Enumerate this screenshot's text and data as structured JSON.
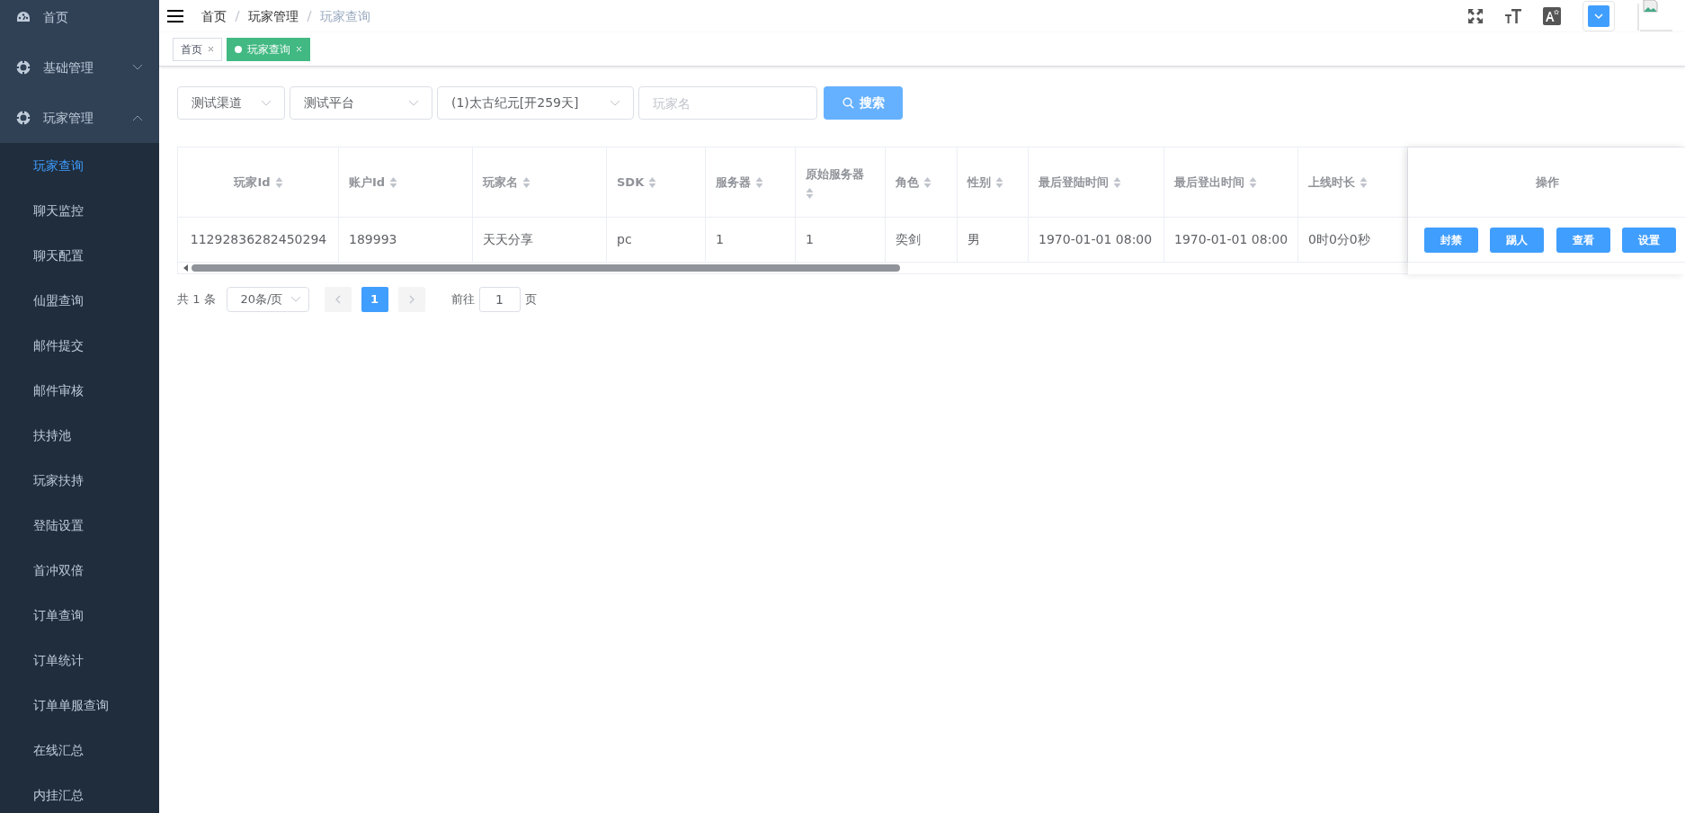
{
  "sidebar": {
    "items": [
      {
        "label": "首页"
      },
      {
        "label": "基础管理",
        "expanded": false
      },
      {
        "label": "玩家管理",
        "expanded": true,
        "children": [
          {
            "label": "玩家查询",
            "selected": true
          },
          {
            "label": "聊天监控",
            "selected": false
          },
          {
            "label": "聊天配置",
            "selected": false
          },
          {
            "label": "仙盟查询",
            "selected": false
          },
          {
            "label": "邮件提交",
            "selected": false
          },
          {
            "label": "邮件审核",
            "selected": false
          },
          {
            "label": "扶持池",
            "selected": false
          },
          {
            "label": "玩家扶持",
            "selected": false
          },
          {
            "label": "登陆设置",
            "selected": false
          },
          {
            "label": "首冲双倍",
            "selected": false
          },
          {
            "label": "订单查询",
            "selected": false
          },
          {
            "label": "订单统计",
            "selected": false
          },
          {
            "label": "订单单服查询",
            "selected": false
          },
          {
            "label": "在线汇总",
            "selected": false
          },
          {
            "label": "内挂汇总",
            "selected": false
          }
        ]
      }
    ]
  },
  "breadcrumb": [
    "首页",
    "玩家管理",
    "玩家查询"
  ],
  "tabs": [
    {
      "label": "首页",
      "selected": false
    },
    {
      "label": "玩家查询",
      "selected": true
    }
  ],
  "filters": {
    "selects": [
      "测试渠道",
      "测试平台",
      "(1)太古纪元[开259天]"
    ],
    "player_name": {
      "placeholder": "玩家名"
    },
    "search_button": "搜索"
  },
  "table": {
    "columns": [
      {
        "label": "玩家Id",
        "sortable": true
      },
      {
        "label": "账户Id",
        "sortable": true
      },
      {
        "label": "玩家名",
        "sortable": true
      },
      {
        "label": "SDK",
        "sortable": true
      },
      {
        "label": "服务器",
        "sortable": true
      },
      {
        "label": "原始服务器",
        "sortable": true
      },
      {
        "label": "角色",
        "sortable": true
      },
      {
        "label": "性别",
        "sortable": true
      },
      {
        "label": "最后登陆时间",
        "sortable": true
      },
      {
        "label": "最后登出时间",
        "sortable": true
      },
      {
        "label": "上线时长",
        "sortable": true
      },
      {
        "label": "操作",
        "sortable": false
      }
    ],
    "rows": [
      {
        "cells": [
          "11292836282450294",
          "189993",
          "天天分享",
          "pc",
          "1",
          "1",
          "奕剑",
          "男",
          "1970-01-01 08:00",
          "1970-01-01 08:00",
          "0时0分0秒"
        ],
        "actions": [
          "封禁",
          "踢人",
          "查看",
          "设置"
        ]
      }
    ]
  },
  "pagination": {
    "total": "共 1 条",
    "page_size": "20条/页",
    "pages": [
      {
        "label": "1",
        "selected": true
      }
    ],
    "goto_label": "前往",
    "goto_value": "1",
    "page_suffix": "页"
  }
}
